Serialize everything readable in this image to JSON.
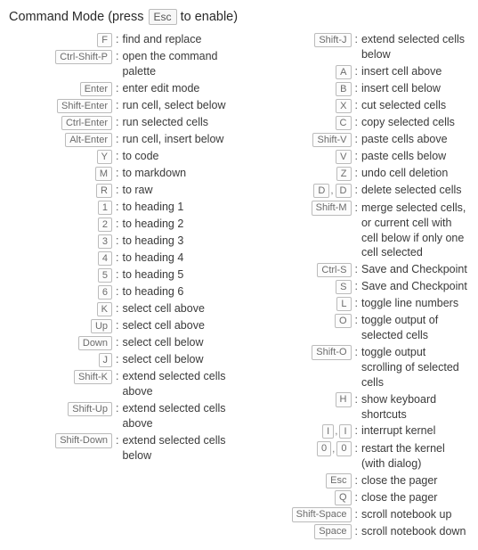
{
  "header": {
    "prefix": "Command Mode (press ",
    "key": "Esc",
    "suffix": " to enable)"
  },
  "left": [
    {
      "keys": [
        "F"
      ],
      "desc": "find and replace"
    },
    {
      "keys": [
        "Ctrl-Shift-P"
      ],
      "desc": "open the command palette"
    },
    {
      "keys": [
        "Enter"
      ],
      "desc": "enter edit mode"
    },
    {
      "keys": [
        "Shift-Enter"
      ],
      "desc": "run cell, select below"
    },
    {
      "keys": [
        "Ctrl-Enter"
      ],
      "desc": "run selected cells"
    },
    {
      "keys": [
        "Alt-Enter"
      ],
      "desc": "run cell, insert below"
    },
    {
      "keys": [
        "Y"
      ],
      "desc": "to code"
    },
    {
      "keys": [
        "M"
      ],
      "desc": "to markdown"
    },
    {
      "keys": [
        "R"
      ],
      "desc": "to raw"
    },
    {
      "keys": [
        "1"
      ],
      "desc": "to heading 1"
    },
    {
      "keys": [
        "2"
      ],
      "desc": "to heading 2"
    },
    {
      "keys": [
        "3"
      ],
      "desc": "to heading 3"
    },
    {
      "keys": [
        "4"
      ],
      "desc": "to heading 4"
    },
    {
      "keys": [
        "5"
      ],
      "desc": "to heading 5"
    },
    {
      "keys": [
        "6"
      ],
      "desc": "to heading 6"
    },
    {
      "keys": [
        "K"
      ],
      "desc": "select cell above"
    },
    {
      "keys": [
        "Up"
      ],
      "desc": "select cell above"
    },
    {
      "keys": [
        "Down"
      ],
      "desc": "select cell below"
    },
    {
      "keys": [
        "J"
      ],
      "desc": "select cell below"
    },
    {
      "keys": [
        "Shift-K"
      ],
      "desc": "extend selected cells above"
    },
    {
      "keys": [
        "Shift-Up"
      ],
      "desc": "extend selected cells above"
    },
    {
      "keys": [
        "Shift-Down"
      ],
      "desc": "extend selected cells below"
    }
  ],
  "right": [
    {
      "keys": [
        "Shift-J"
      ],
      "desc": "extend selected cells below"
    },
    {
      "keys": [
        "A"
      ],
      "desc": "insert cell above"
    },
    {
      "keys": [
        "B"
      ],
      "desc": "insert cell below"
    },
    {
      "keys": [
        "X"
      ],
      "desc": "cut selected cells"
    },
    {
      "keys": [
        "C"
      ],
      "desc": "copy selected cells"
    },
    {
      "keys": [
        "Shift-V"
      ],
      "desc": "paste cells above"
    },
    {
      "keys": [
        "V"
      ],
      "desc": "paste cells below"
    },
    {
      "keys": [
        "Z"
      ],
      "desc": "undo cell deletion"
    },
    {
      "keys": [
        "D",
        "D"
      ],
      "desc": "delete selected cells"
    },
    {
      "keys": [
        "Shift-M"
      ],
      "desc": "merge selected cells, or current cell with cell below if only one cell selected"
    },
    {
      "keys": [
        "Ctrl-S"
      ],
      "desc": "Save and Checkpoint"
    },
    {
      "keys": [
        "S"
      ],
      "desc": "Save and Checkpoint"
    },
    {
      "keys": [
        "L"
      ],
      "desc": "toggle line numbers"
    },
    {
      "keys": [
        "O"
      ],
      "desc": "toggle output of selected cells"
    },
    {
      "keys": [
        "Shift-O"
      ],
      "desc": "toggle output scrolling of selected cells"
    },
    {
      "keys": [
        "H"
      ],
      "desc": "show keyboard shortcuts"
    },
    {
      "keys": [
        "I",
        "I"
      ],
      "desc": "interrupt kernel"
    },
    {
      "keys": [
        "0",
        "0"
      ],
      "desc": "restart the kernel (with dialog)"
    },
    {
      "keys": [
        "Esc"
      ],
      "desc": "close the pager"
    },
    {
      "keys": [
        "Q"
      ],
      "desc": "close the pager"
    },
    {
      "keys": [
        "Shift-Space"
      ],
      "desc": "scroll notebook up"
    },
    {
      "keys": [
        "Space"
      ],
      "desc": "scroll notebook down"
    }
  ]
}
